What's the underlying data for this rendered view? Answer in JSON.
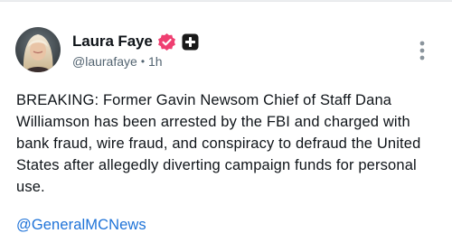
{
  "post": {
    "author": {
      "display_name": "Laura Faye",
      "handle": "@laurafaye",
      "separator": "•",
      "time": "1h",
      "verified_color": "#ef3f71",
      "icons": [
        "avatar-photo",
        "verified-badge-icon",
        "plus-badge-icon"
      ]
    },
    "body": "BREAKING: Former Gavin Newsom Chief of Staff Dana Williamson has been arrested by the FBI and charged with bank fraud, wire fraud, and conspiracy to defraud the United States after allegedly diverting campaign funds for personal use.",
    "mention": "@GeneralMCNews",
    "menu_icon": "more-vertical-icon",
    "colors": {
      "text": "#0f1419",
      "secondary": "#536471",
      "link": "#1d72d8"
    }
  }
}
